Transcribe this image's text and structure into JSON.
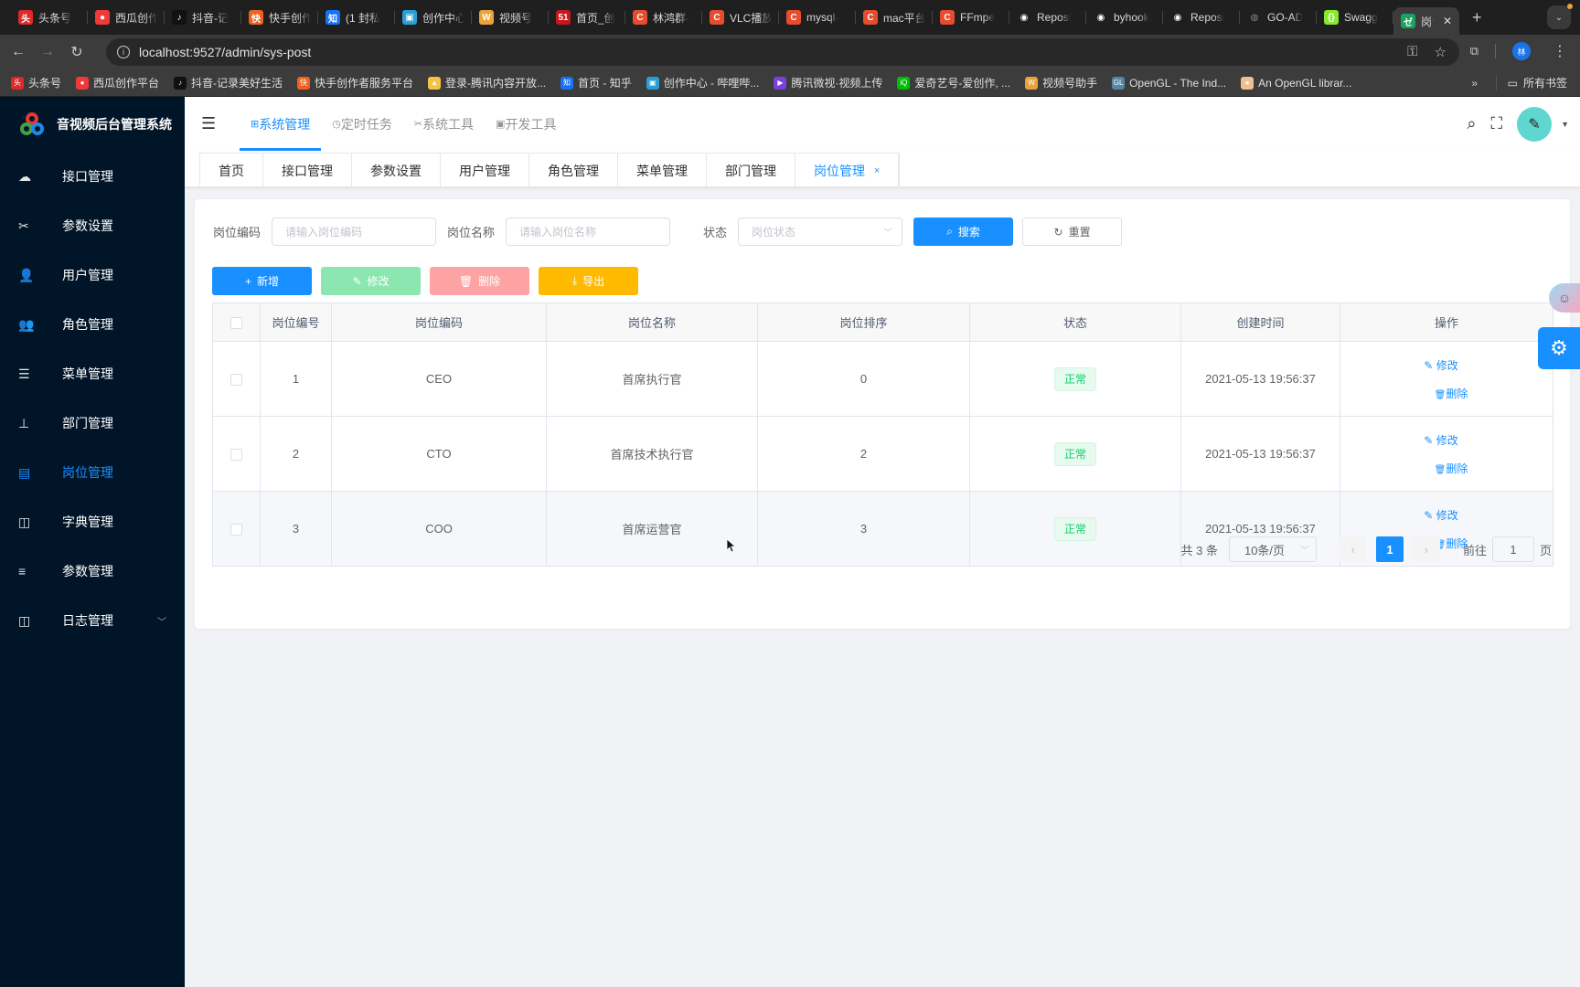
{
  "browser": {
    "tabs": [
      {
        "title": "头条号",
        "icon": "toutiao-icon",
        "color": "#e02828",
        "glyph": "头"
      },
      {
        "title": "西瓜创作",
        "icon": "xigua-icon",
        "color": "#f03a3a",
        "glyph": "●"
      },
      {
        "title": "抖音-记",
        "icon": "douyin-icon",
        "color": "#111111",
        "glyph": "♪"
      },
      {
        "title": "快手创作",
        "icon": "kuaishou-icon",
        "color": "#f06020",
        "glyph": "快"
      },
      {
        "title": "(1 封私",
        "icon": "zhihu-icon",
        "color": "#1772f6",
        "glyph": "知"
      },
      {
        "title": "创作中心",
        "icon": "bilibili-icon",
        "color": "#2a9fd6",
        "glyph": "▣"
      },
      {
        "title": "视频号",
        "icon": "wechat-channels-icon",
        "color": "#e8a33a",
        "glyph": "W"
      },
      {
        "title": "首页_创",
        "icon": "51cto-icon",
        "color": "#c8161d",
        "glyph": "51"
      },
      {
        "title": "林鸿群-",
        "icon": "csdn-icon",
        "color": "#e64c2e",
        "glyph": "C"
      },
      {
        "title": "VLC播放",
        "icon": "csdn-icon",
        "color": "#e64c2e",
        "glyph": "C"
      },
      {
        "title": "mysql-",
        "icon": "csdn-icon",
        "color": "#e64c2e",
        "glyph": "C"
      },
      {
        "title": "mac平台",
        "icon": "csdn-icon",
        "color": "#e64c2e",
        "glyph": "C"
      },
      {
        "title": "FFmpe",
        "icon": "csdn-icon",
        "color": "#e64c2e",
        "glyph": "C"
      },
      {
        "title": "Reposi",
        "icon": "github-icon",
        "color": "#ffffff",
        "glyph": "◉"
      },
      {
        "title": "byhook",
        "icon": "github-icon",
        "color": "#ffffff",
        "glyph": "◉"
      },
      {
        "title": "Reposi",
        "icon": "github-icon",
        "color": "#ffffff",
        "glyph": "◉"
      },
      {
        "title": "GO-AD",
        "icon": "globe-icon",
        "color": "#888888",
        "glyph": "◍"
      },
      {
        "title": "Swagg",
        "icon": "swagger-icon",
        "color": "#85ea2d",
        "glyph": "{}"
      },
      {
        "title": "岗位",
        "icon": "vue-admin-icon",
        "color": "#1aa260",
        "glyph": "ゼ",
        "active": true
      }
    ],
    "url": "localhost:9527/admin/sys-post",
    "bookmarks": [
      {
        "title": "头条号",
        "color": "#e02828",
        "glyph": "头"
      },
      {
        "title": "西瓜创作平台",
        "color": "#f03a3a",
        "glyph": "●"
      },
      {
        "title": "抖音-记录美好生活",
        "color": "#111111",
        "glyph": "♪"
      },
      {
        "title": "快手创作者服务平台",
        "color": "#f06020",
        "glyph": "快"
      },
      {
        "title": "登录-腾讯内容开放...",
        "color": "#f6c342",
        "glyph": "▲"
      },
      {
        "title": "首页 - 知乎",
        "color": "#1772f6",
        "glyph": "知"
      },
      {
        "title": "创作中心 - 哔哩哔...",
        "color": "#2a9fd6",
        "glyph": "▣"
      },
      {
        "title": "腾讯微视·视频上传",
        "color": "#7b3fe4",
        "glyph": "▶"
      },
      {
        "title": "爱奇艺号-爱创作, ...",
        "color": "#00be06",
        "glyph": "iQ"
      },
      {
        "title": "视频号助手",
        "color": "#e8a33a",
        "glyph": "W"
      },
      {
        "title": "OpenGL - The Ind...",
        "color": "#5586a4",
        "glyph": "GL"
      },
      {
        "title": "An OpenGL librar...",
        "color": "#f0c090",
        "glyph": "●"
      }
    ],
    "bookmarks_more": "»",
    "all_bookmarks": "所有书签",
    "profile_initial": "林"
  },
  "app": {
    "title": "音视频后台管理系统",
    "sidebar": [
      {
        "label": "接口管理",
        "icon": "cloud-icon",
        "glyph": "☁"
      },
      {
        "label": "参数设置",
        "icon": "tools-icon",
        "glyph": "✂"
      },
      {
        "label": "用户管理",
        "icon": "user-icon",
        "glyph": "👤"
      },
      {
        "label": "角色管理",
        "icon": "role-icon",
        "glyph": "👥"
      },
      {
        "label": "菜单管理",
        "icon": "menu-tree-icon",
        "glyph": "☰"
      },
      {
        "label": "部门管理",
        "icon": "org-tree-icon",
        "glyph": "⊥"
      },
      {
        "label": "岗位管理",
        "icon": "post-icon",
        "glyph": "▤",
        "active": true
      },
      {
        "label": "字典管理",
        "icon": "book-icon",
        "glyph": "◫"
      },
      {
        "label": "参数管理",
        "icon": "sliders-icon",
        "glyph": "≡"
      },
      {
        "label": "日志管理",
        "icon": "log-icon",
        "glyph": "◫",
        "expandable": true
      }
    ],
    "topnav": [
      {
        "label": "系统管理",
        "glyph": "⊞",
        "active": true
      },
      {
        "label": "定时任务",
        "glyph": "◷"
      },
      {
        "label": "系统工具",
        "glyph": "✂"
      },
      {
        "label": "开发工具",
        "glyph": "▣"
      }
    ],
    "tags": [
      {
        "label": "首页"
      },
      {
        "label": "接口管理"
      },
      {
        "label": "参数设置"
      },
      {
        "label": "用户管理"
      },
      {
        "label": "角色管理"
      },
      {
        "label": "菜单管理"
      },
      {
        "label": "部门管理"
      },
      {
        "label": "岗位管理",
        "active": true,
        "closable": true
      }
    ],
    "tag_close": "×"
  },
  "search": {
    "post_code_label": "岗位编码",
    "post_code_placeholder": "请输入岗位编码",
    "post_name_label": "岗位名称",
    "post_name_placeholder": "请输入岗位名称",
    "status_label": "状态",
    "status_placeholder": "岗位状态",
    "search_btn": "搜索",
    "reset_btn": "重置"
  },
  "toolbar": {
    "add": "新增",
    "edit": "修改",
    "delete": "删除",
    "export": "导出"
  },
  "table": {
    "columns": [
      "岗位编号",
      "岗位编码",
      "岗位名称",
      "岗位排序",
      "状态",
      "创建时间",
      "操作"
    ],
    "rows": [
      {
        "id": "1",
        "code": "CEO",
        "name": "首席执行官",
        "sort": "0",
        "status": "正常",
        "created": "2021-05-13 19:56:37"
      },
      {
        "id": "2",
        "code": "CTO",
        "name": "首席技术执行官",
        "sort": "2",
        "status": "正常",
        "created": "2021-05-13 19:56:37"
      },
      {
        "id": "3",
        "code": "COO",
        "name": "首席运营官",
        "sort": "3",
        "status": "正常",
        "created": "2021-05-13 19:56:37"
      }
    ],
    "edit_action": "修改",
    "delete_action": "删除"
  },
  "pagination": {
    "total_text": "共 3 条",
    "page_size": "10条/页",
    "current_page": "1",
    "goto_label": "前往",
    "goto_value": "1",
    "page_suffix": "页"
  },
  "colors": {
    "primary": "#1890ff",
    "sidebar_bg": "#011528",
    "success": "#13ce66",
    "warning": "#ffba00",
    "danger_light": "#fda3a3",
    "success_light": "#8ce6b0"
  }
}
